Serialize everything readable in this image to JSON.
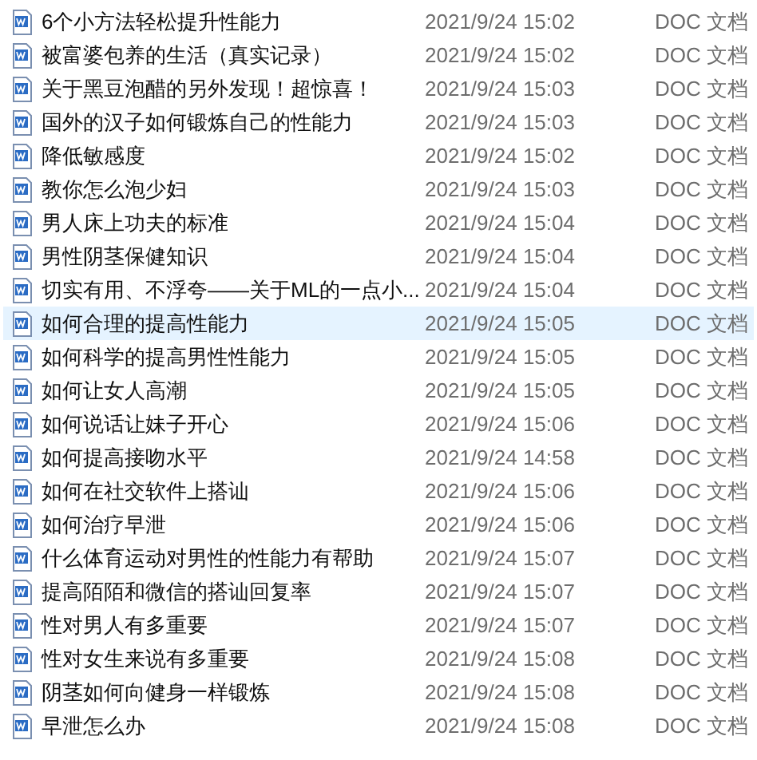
{
  "files": [
    {
      "name": "6个小方法轻松提升性能力",
      "date": "2021/9/24 15:02",
      "type": "DOC 文档",
      "selected": false
    },
    {
      "name": "被富婆包养的生活（真实记录）",
      "date": "2021/9/24 15:02",
      "type": "DOC 文档",
      "selected": false
    },
    {
      "name": "关于黑豆泡醋的另外发现！超惊喜！",
      "date": "2021/9/24 15:03",
      "type": "DOC 文档",
      "selected": false
    },
    {
      "name": "国外的汉子如何锻炼自己的性能力",
      "date": "2021/9/24 15:03",
      "type": "DOC 文档",
      "selected": false
    },
    {
      "name": "降低敏感度",
      "date": "2021/9/24 15:02",
      "type": "DOC 文档",
      "selected": false
    },
    {
      "name": "教你怎么泡少妇",
      "date": "2021/9/24 15:03",
      "type": "DOC 文档",
      "selected": false
    },
    {
      "name": "男人床上功夫的标准",
      "date": "2021/9/24 15:04",
      "type": "DOC 文档",
      "selected": false
    },
    {
      "name": "男性阴茎保健知识",
      "date": "2021/9/24 15:04",
      "type": "DOC 文档",
      "selected": false
    },
    {
      "name": "切实有用、不浮夸——关于ML的一点小...",
      "date": "2021/9/24 15:04",
      "type": "DOC 文档",
      "selected": false
    },
    {
      "name": "如何合理的提高性能力",
      "date": "2021/9/24 15:05",
      "type": "DOC 文档",
      "selected": true
    },
    {
      "name": "如何科学的提高男性性能力",
      "date": "2021/9/24 15:05",
      "type": "DOC 文档",
      "selected": false
    },
    {
      "name": "如何让女人高潮",
      "date": "2021/9/24 15:05",
      "type": "DOC 文档",
      "selected": false
    },
    {
      "name": "如何说话让妹子开心",
      "date": "2021/9/24 15:06",
      "type": "DOC 文档",
      "selected": false
    },
    {
      "name": "如何提高接吻水平",
      "date": "2021/9/24 14:58",
      "type": "DOC 文档",
      "selected": false
    },
    {
      "name": "如何在社交软件上搭讪",
      "date": "2021/9/24 15:06",
      "type": "DOC 文档",
      "selected": false
    },
    {
      "name": "如何治疗早泄",
      "date": "2021/9/24 15:06",
      "type": "DOC 文档",
      "selected": false
    },
    {
      "name": "什么体育运动对男性的性能力有帮助",
      "date": "2021/9/24 15:07",
      "type": "DOC 文档",
      "selected": false
    },
    {
      "name": "提高陌陌和微信的搭讪回复率",
      "date": "2021/9/24 15:07",
      "type": "DOC 文档",
      "selected": false
    },
    {
      "name": "性对男人有多重要",
      "date": "2021/9/24 15:07",
      "type": "DOC 文档",
      "selected": false
    },
    {
      "name": "性对女生来说有多重要",
      "date": "2021/9/24 15:08",
      "type": "DOC 文档",
      "selected": false
    },
    {
      "name": "阴茎如何向健身一样锻炼",
      "date": "2021/9/24 15:08",
      "type": "DOC 文档",
      "selected": false
    },
    {
      "name": "早泄怎么办",
      "date": "2021/9/24 15:08",
      "type": "DOC 文档",
      "selected": false
    }
  ]
}
